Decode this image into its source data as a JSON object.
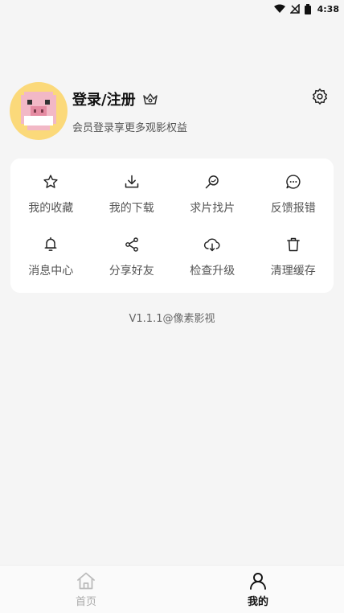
{
  "status_bar": {
    "time": "4:38"
  },
  "profile": {
    "title": "登录/注册",
    "subtitle": "会员登录享更多观影权益"
  },
  "menu": {
    "items": [
      {
        "label": "我的收藏",
        "icon": "star-icon"
      },
      {
        "label": "我的下载",
        "icon": "download-icon"
      },
      {
        "label": "求片找片",
        "icon": "search-icon"
      },
      {
        "label": "反馈报错",
        "icon": "chat-bubble-icon"
      },
      {
        "label": "消息中心",
        "icon": "bell-icon"
      },
      {
        "label": "分享好友",
        "icon": "share-icon"
      },
      {
        "label": "检查升级",
        "icon": "cloud-download-icon"
      },
      {
        "label": "清理缓存",
        "icon": "trash-icon"
      }
    ]
  },
  "version": "V1.1.1@像素影视",
  "bottom_nav": {
    "items": [
      {
        "label": "首页",
        "icon": "home-icon",
        "active": false
      },
      {
        "label": "我的",
        "icon": "user-icon",
        "active": true
      }
    ]
  },
  "colors": {
    "background": "#f5f5f5",
    "card": "#ffffff",
    "avatar_bg": "#fbd97a",
    "text_primary": "#111111",
    "text_secondary": "#555555"
  }
}
